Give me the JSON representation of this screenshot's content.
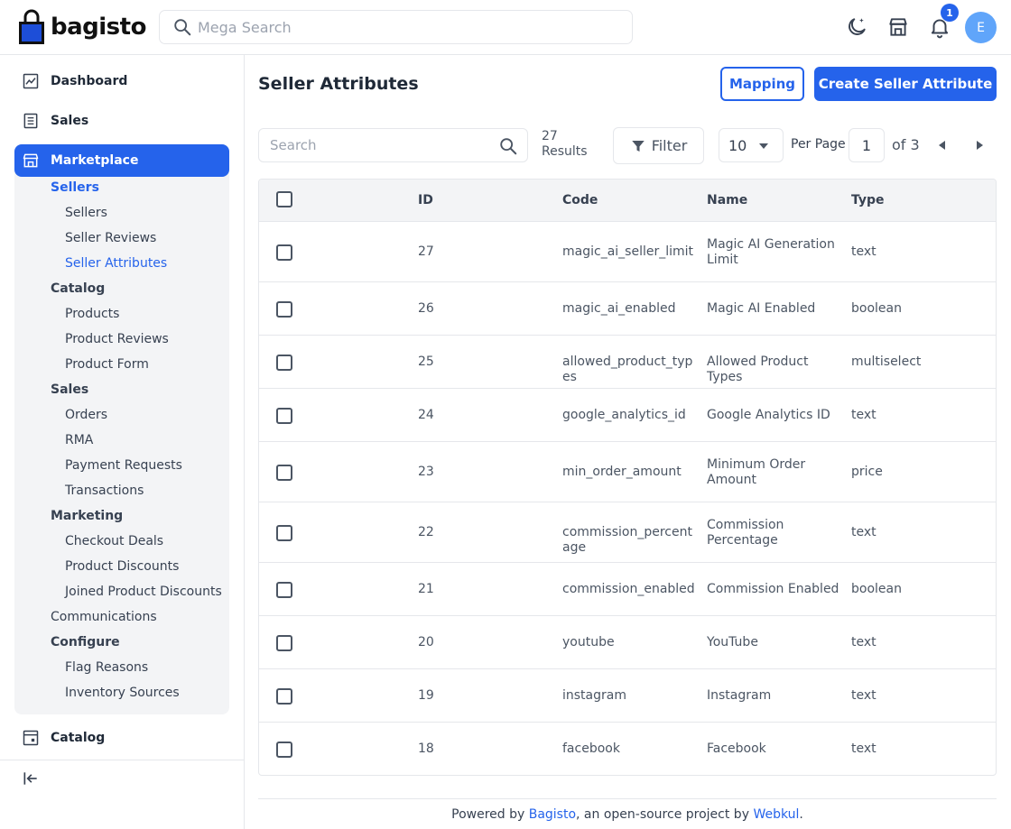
{
  "header": {
    "logo_text": "bagisto",
    "mega_search_placeholder": "Mega Search",
    "notification_count": "1",
    "avatar_initial": "E"
  },
  "sidebar": {
    "dashboard": "Dashboard",
    "sales": "Sales",
    "marketplace": "Marketplace",
    "catalog": "Catalog",
    "sub": [
      {
        "label": "Sellers",
        "kind": "group",
        "active": true
      },
      {
        "label": "Sellers",
        "kind": "leaf",
        "active": false
      },
      {
        "label": "Seller Reviews",
        "kind": "leaf",
        "active": false
      },
      {
        "label": "Seller Attributes",
        "kind": "leaf",
        "active": true
      },
      {
        "label": "Catalog",
        "kind": "group",
        "active": false
      },
      {
        "label": "Products",
        "kind": "leaf",
        "active": false
      },
      {
        "label": "Product Reviews",
        "kind": "leaf",
        "active": false
      },
      {
        "label": "Product Form",
        "kind": "leaf",
        "active": false
      },
      {
        "label": "Sales",
        "kind": "group",
        "active": false
      },
      {
        "label": "Orders",
        "kind": "leaf",
        "active": false
      },
      {
        "label": "RMA",
        "kind": "leaf",
        "active": false
      },
      {
        "label": "Payment Requests",
        "kind": "leaf",
        "active": false
      },
      {
        "label": "Transactions",
        "kind": "leaf",
        "active": false
      },
      {
        "label": "Marketing",
        "kind": "group",
        "active": false
      },
      {
        "label": "Checkout Deals",
        "kind": "leaf",
        "active": false
      },
      {
        "label": "Product Discounts",
        "kind": "leaf",
        "active": false
      },
      {
        "label": "Joined Product Discounts",
        "kind": "leaf",
        "active": false
      },
      {
        "label": "Communications",
        "kind": "group-plain",
        "active": false
      },
      {
        "label": "Configure",
        "kind": "group",
        "active": false
      },
      {
        "label": "Flag Reasons",
        "kind": "leaf",
        "active": false
      },
      {
        "label": "Inventory Sources",
        "kind": "leaf",
        "active": false
      }
    ]
  },
  "page": {
    "title": "Seller Attributes",
    "mapping_label": "Mapping",
    "create_label": "Create Seller Attribute"
  },
  "toolbar": {
    "search_placeholder": "Search",
    "results_count": "27",
    "results_label": "Results",
    "filter_label": "Filter",
    "per_page_value": "10",
    "per_page_label": "Per Page",
    "current_page": "1",
    "total_pages_label": "of 3"
  },
  "table": {
    "headers": {
      "id": "ID",
      "code": "Code",
      "name": "Name",
      "type": "Type"
    },
    "rows": [
      {
        "id": "27",
        "code": "magic_ai_seller_limit",
        "name": "Magic AI Generation Limit",
        "type": "text"
      },
      {
        "id": "26",
        "code": "magic_ai_enabled",
        "name": "Magic AI Enabled",
        "type": "boolean"
      },
      {
        "id": "25",
        "code": "allowed_product_types",
        "name": "Allowed Product Types",
        "type": "multiselect"
      },
      {
        "id": "24",
        "code": "google_analytics_id",
        "name": "Google Analytics ID",
        "type": "text"
      },
      {
        "id": "23",
        "code": "min_order_amount",
        "name": "Minimum Order Amount",
        "type": "price"
      },
      {
        "id": "22",
        "code": "commission_percentage",
        "name": "Commission Percentage",
        "type": "text"
      },
      {
        "id": "21",
        "code": "commission_enabled",
        "name": "Commission Enabled",
        "type": "boolean"
      },
      {
        "id": "20",
        "code": "youtube",
        "name": "YouTube",
        "type": "text"
      },
      {
        "id": "19",
        "code": "instagram",
        "name": "Instagram",
        "type": "text"
      },
      {
        "id": "18",
        "code": "facebook",
        "name": "Facebook",
        "type": "text"
      }
    ]
  },
  "footer": {
    "prefix": "Powered by ",
    "brand": "Bagisto",
    "middle": ", an open-source project by ",
    "company": "Webkul",
    "suffix": "."
  }
}
